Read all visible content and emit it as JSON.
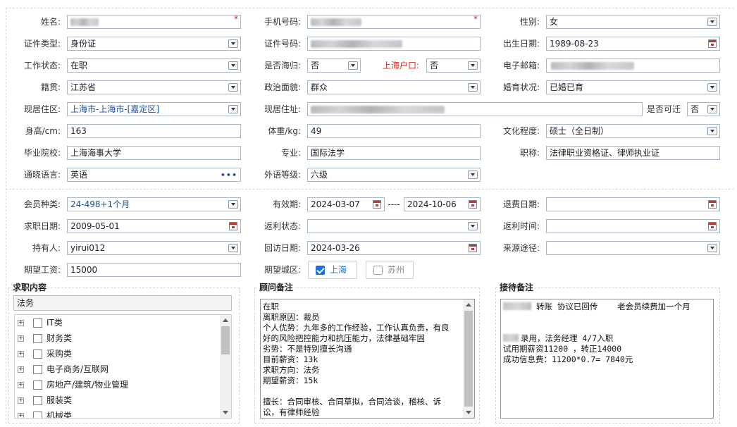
{
  "basic": {
    "name_label": "姓名:",
    "phone_label": "手机号码:",
    "gender_label": "性别:",
    "gender_value": "女",
    "id_type_label": "证件类型:",
    "id_type_value": "身份证",
    "id_no_label": "证件号码:",
    "birth_label": "出生日期:",
    "birth_value": "1989-08-23",
    "work_status_label": "工作状态:",
    "work_status_value": "在职",
    "returnee_label": "是否海归:",
    "returnee_value": "否",
    "hukou_label": "上海户口:",
    "hukou_value": "否",
    "email_label": "电子邮箱:",
    "native_label": "籍贯:",
    "native_value": "江苏省",
    "political_label": "政治面貌:",
    "political_value": "群众",
    "marital_label": "婚育状况:",
    "marital_value": "已婚已育",
    "residence_area_label": "现居住区:",
    "residence_area_value": "上海市-上海市-[嘉定区]",
    "address_label": "现居住址:",
    "relocate_label": "是否可迁",
    "relocate_value": "否",
    "height_label": "身高/cm:",
    "height_value": "163",
    "weight_label": "体重/kg:",
    "weight_value": "49",
    "education_label": "文化程度:",
    "education_value": "硕士（全日制）",
    "school_label": "毕业院校:",
    "school_value": "上海海事大学",
    "major_label": "专业:",
    "major_value": "国际法学",
    "title_label": "职称:",
    "title_value": "法律职业资格证、律师执业证",
    "language_label": "通晓语言:",
    "language_value": "英语",
    "foreign_level_label": "外语等级:",
    "foreign_level_value": "六级"
  },
  "member": {
    "member_type_label": "会员种类:",
    "member_type_value": "24-498+1个月",
    "validity_label": "有效期:",
    "validity_start": "2024-03-07",
    "validity_sep": "----",
    "validity_end": "2024-10-06",
    "refund_date_label": "退费日期:",
    "jobseek_date_label": "求职日期:",
    "jobseek_date_value": "2009-05-01",
    "rebate_status_label": "返利状态:",
    "rebate_time_label": "返利时间:",
    "holder_label": "持有人:",
    "holder_value": "yirui012",
    "revisit_date_label": "回访日期:",
    "revisit_date_value": "2024-03-26",
    "source_label": "来源途径:",
    "expected_salary_label": "期望工资:",
    "expected_salary_value": "15000",
    "expected_city_label": "期望城区:",
    "city_options": [
      {
        "label": "上海",
        "checked": true
      },
      {
        "label": "苏州",
        "checked": false
      }
    ]
  },
  "job_content": {
    "title": "求职内容",
    "selected_text": "法务",
    "categories": [
      "IT类",
      "财务类",
      "采购类",
      "电子商务/互联网",
      "房地产/建筑/物业管理",
      "服装类",
      "机械类"
    ]
  },
  "advisor_notes": {
    "title": "顾问备注",
    "text": "在职\n离职原因：裁员\n个人优势：九年多的工作经验，工作认真负责，有良\n好的风险把控能力和抗压能力，法律基础牢固\n劣势：不是特别擅长沟通\n目前薪资：13k\n求职方向：法务\n期望薪资：15k\n\n擅长：合同审核、合同草拟，合同洽谈，稽核、诉\n讼，有律师经验"
  },
  "reception_notes": {
    "title": "接待备注",
    "line1": "转账 协议已回传    老会员续费加一个月",
    "line2": "录用，法务经理 4/7入职",
    "line3": "试用期薪资11200 ，转正14000",
    "line4": "成功信息费：11200*0.7= 7840元"
  },
  "colors": {
    "border": "#a9b8c8",
    "required": "#e02020",
    "accent": "#1c6fd6",
    "label_red": "#e02020"
  }
}
